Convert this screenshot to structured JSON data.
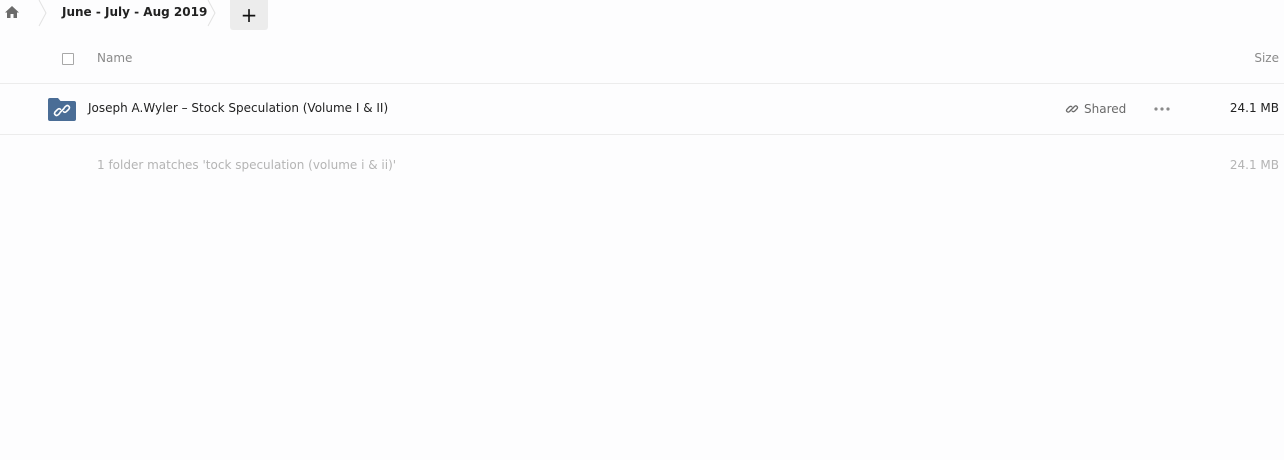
{
  "breadcrumb": {
    "home_icon": "home-icon",
    "current": "June - July - Aug 2019",
    "add_label": "+"
  },
  "table": {
    "header": {
      "name": "Name",
      "size": "Size"
    },
    "rows": [
      {
        "icon": "shared-folder-icon",
        "name": "Joseph A.Wyler – Stock Speculation (Volume I & II)",
        "share_label": "Shared",
        "size": "24.1 MB"
      }
    ],
    "summary": {
      "text": "1 folder matches 'tock speculation (volume i & ii)'",
      "size": "24.1 MB"
    }
  },
  "colors": {
    "folder": "#4a6d96",
    "muted_text": "#b4b4b4",
    "header_text": "#8a8a8a",
    "add_button_bg": "#ececec"
  }
}
